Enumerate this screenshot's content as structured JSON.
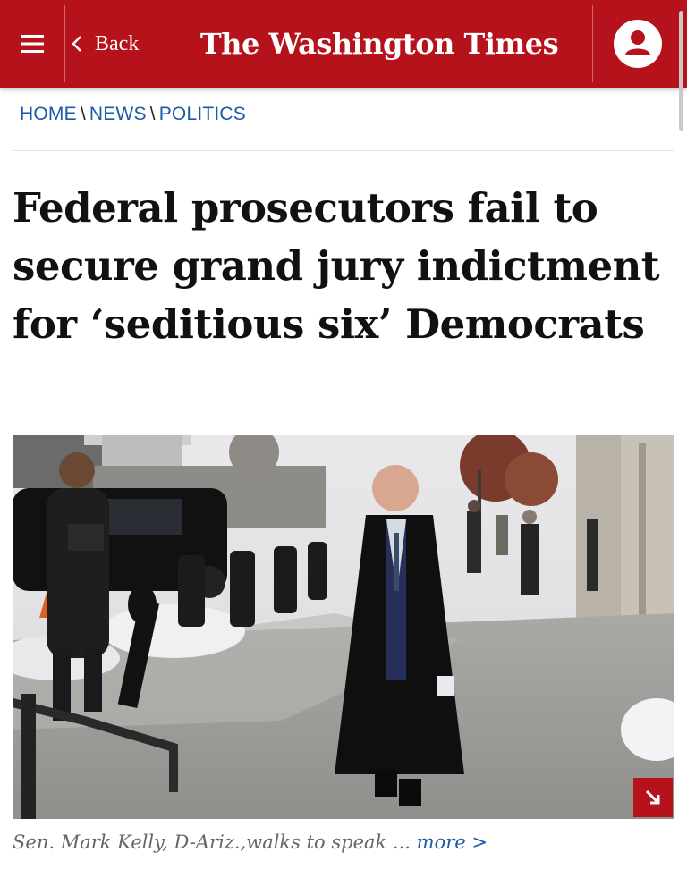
{
  "header": {
    "back_label": "Back",
    "logo_text": "The Washington Times",
    "bg_color": "#b5121b"
  },
  "breadcrumb": {
    "items": [
      "HOME",
      "NEWS",
      "POLITICS"
    ],
    "separator": "\\"
  },
  "article": {
    "headline": "Federal prosecutors fail to secure grand jury indictment for ‘seditious six’ Democrats",
    "caption": "Sen. Mark Kelly, D-Ariz.,walks to speak ...",
    "more_label": "more >"
  },
  "icons": {
    "menu": "hamburger-menu-icon",
    "back": "chevron-left-icon",
    "account": "user-account-icon",
    "expand": "expand-arrow-icon"
  },
  "colors": {
    "link": "#1a5aa8",
    "accent": "#b5121b"
  }
}
